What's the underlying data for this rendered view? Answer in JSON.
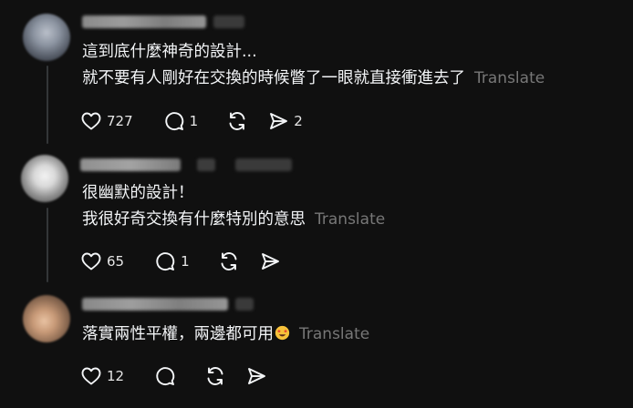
{
  "comments": [
    {
      "author_obscured": true,
      "text_lines": [
        "這到底什麼神奇的設計...",
        "就不要有人剛好在交換的時候瞥了一眼就直接衝進去了"
      ],
      "translate_label": "Translate",
      "likes": "727",
      "replies": "1",
      "reposts": "",
      "shares": "2"
    },
    {
      "author_obscured": true,
      "text_lines": [
        "很幽默的設計！",
        "我很好奇交換有什麼特別的意思"
      ],
      "translate_label": "Translate",
      "likes": "65",
      "replies": "1",
      "reposts": "",
      "shares": ""
    },
    {
      "author_obscured": true,
      "text_lines": [
        "落實兩性平權，兩邊都可用"
      ],
      "emoji": "star-struck-emoji",
      "translate_label": "Translate",
      "likes": "12",
      "replies": "",
      "reposts": "",
      "shares": ""
    }
  ],
  "icons": {
    "like": "heart-icon",
    "reply": "comment-bubble-icon",
    "repost": "repost-arrows-icon",
    "share": "send-paper-plane-icon"
  },
  "colors": {
    "background": "#101010",
    "text": "#f3f5f7",
    "translate": "#777777",
    "thread_line": "#333638"
  }
}
